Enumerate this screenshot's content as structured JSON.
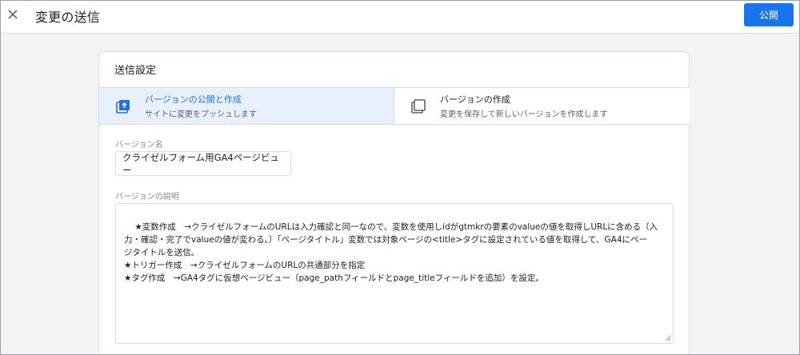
{
  "header": {
    "title": "変更の送信",
    "publish_label": "公開"
  },
  "card": {
    "title": "送信設定",
    "options": [
      {
        "title": "バージョンの公開と作成",
        "subtitle": "サイトに変更をプッシュします",
        "selected": true,
        "icon": "publish-icon"
      },
      {
        "title": "バージョンの作成",
        "subtitle": "変更を保存して新しいバージョンを作成します",
        "selected": false,
        "icon": "copy-icon"
      }
    ],
    "version_name": {
      "label": "バージョン名",
      "value": "クライゼルフォーム用GA4ページビュー"
    },
    "version_description": {
      "label": "バージョンの説明",
      "value": "★変数作成　→クライゼルフォームのURLは入力確認と同一なので、変数を使用しidがgtmkrの要素のvalueの値を取得しURLに含める（入\n力・確認・完了でvalueの値が変わる。）「ページタイトル」変数では対象ページの<title>タグに設定されている値を取得して、GA4にペー\nジタイトルを送信。\n★トリガー作成　→クライゼルフォームのURLの共通部分を指定\n★タグ作成　→GA4タグに仮想ページビュー（page_pathフィールドとpage_titleフィールドを追加）を設定。"
    }
  },
  "colors": {
    "accent": "#1a73e8",
    "selected_bg": "#e8f0fe",
    "page_bg": "#f1f3f4"
  }
}
